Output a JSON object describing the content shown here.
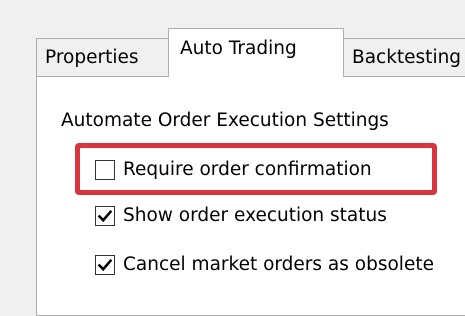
{
  "tabs": [
    {
      "label": "Properties",
      "active": false
    },
    {
      "label": "Auto Trading",
      "active": true
    },
    {
      "label": "Backtesting",
      "active": false
    }
  ],
  "auto_trading": {
    "group_label": "Automate Order Execution Settings",
    "options": [
      {
        "label": "Require order confirmation",
        "checked": false,
        "highlighted": true
      },
      {
        "label": "Show order execution status",
        "checked": true,
        "highlighted": false
      },
      {
        "label": "Cancel market orders as obsolete",
        "checked": true,
        "highlighted": false
      }
    ]
  },
  "colors": {
    "highlight": "#d9343d",
    "panel_background": "#ffffff",
    "dialog_background": "#f0f0f0",
    "tab_border": "#adadad"
  }
}
